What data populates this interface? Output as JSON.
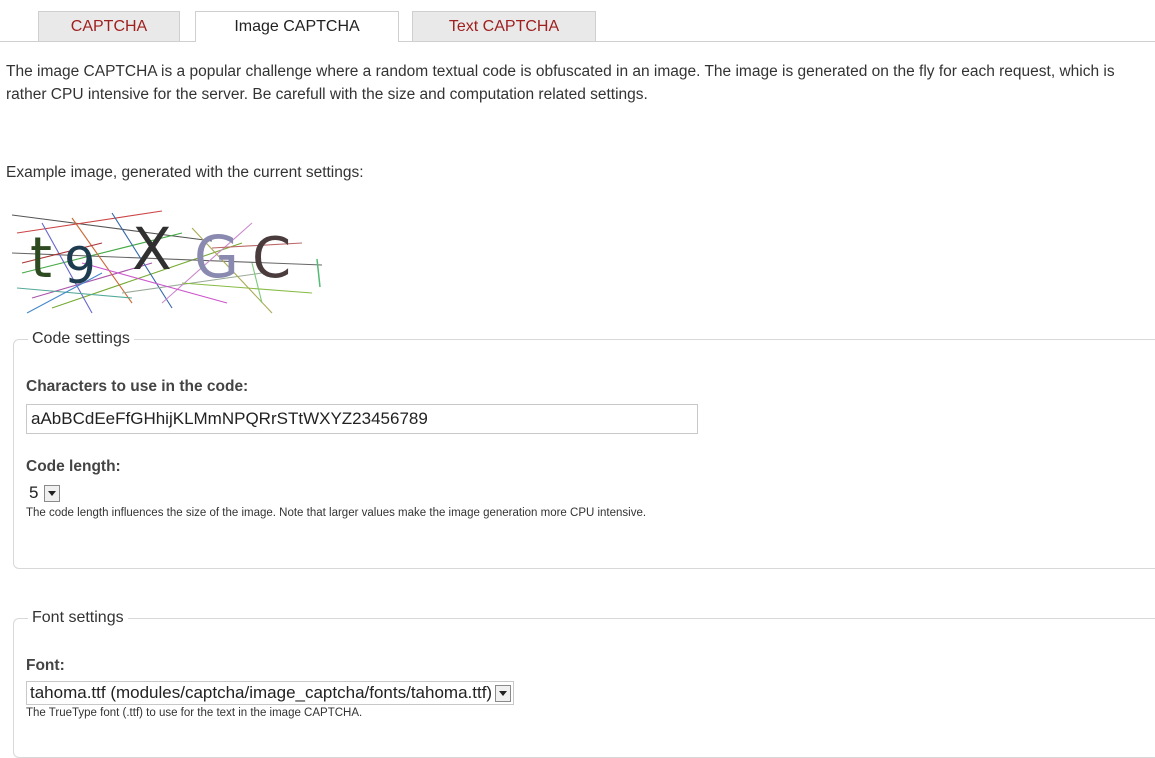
{
  "tabs": [
    {
      "label": "CAPTCHA",
      "active": false
    },
    {
      "label": "Image CAPTCHA",
      "active": true
    },
    {
      "label": "Text CAPTCHA",
      "active": false
    }
  ],
  "intro": "The image CAPTCHA is a popular challenge where a random textual code is obfuscated in an image. The image is generated on the fly for each request, which is rather CPU intensive for the server. Be carefull with the size and computation related settings.",
  "example_label": "Example image, generated with the current settings:",
  "captcha_image": {
    "code": "t9XGC"
  },
  "code_settings": {
    "legend": "Code settings",
    "characters_label": "Characters to use in the code:",
    "characters_value": "aAbBCdEeFfGHhijKLMmNPQRrSTtWXYZ23456789",
    "length_label": "Code length:",
    "length_value": "5",
    "length_description": "The code length influences the size of the image. Note that larger values make the image generation more CPU intensive."
  },
  "font_settings": {
    "legend": "Font settings",
    "font_label": "Font:",
    "font_value": "tahoma.ttf (modules/captcha/image_captcha/fonts/tahoma.ttf)",
    "font_description": "The TrueType font (.ttf) to use for the text in the image CAPTCHA."
  },
  "colors": {
    "tab_link": "#a02020",
    "border": "#cfcfcf"
  }
}
